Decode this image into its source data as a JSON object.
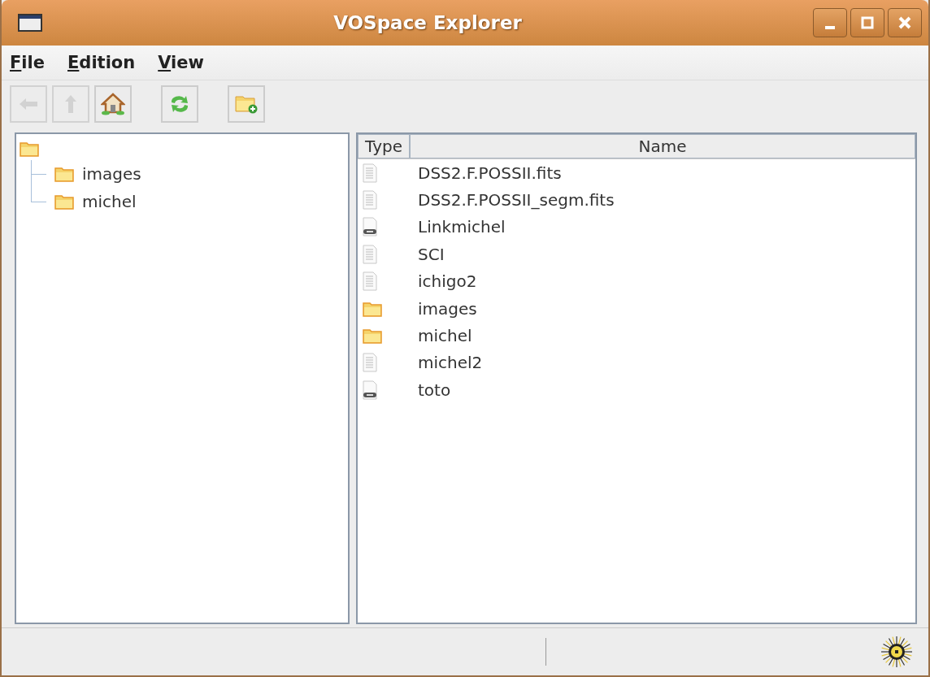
{
  "window": {
    "title": "VOSpace Explorer"
  },
  "menu": [
    "File",
    "Edition",
    "View"
  ],
  "toolbar": [
    {
      "kind": "back",
      "disabled": true
    },
    {
      "kind": "up",
      "disabled": true
    },
    {
      "kind": "home",
      "disabled": false
    },
    {
      "kind": "refresh",
      "disabled": false
    },
    {
      "kind": "new-folder",
      "disabled": false
    }
  ],
  "tree": {
    "children": [
      {
        "label": "images"
      },
      {
        "label": "michel"
      }
    ]
  },
  "table": {
    "columns": [
      "Type",
      "Name"
    ],
    "rows": [
      {
        "kind": "file",
        "name": "DSS2.F.POSSII.fits"
      },
      {
        "kind": "file",
        "name": "DSS2.F.POSSII_segm.fits"
      },
      {
        "kind": "link",
        "name": "Linkmichel"
      },
      {
        "kind": "file",
        "name": "SCI"
      },
      {
        "kind": "file",
        "name": "ichigo2"
      },
      {
        "kind": "folder",
        "name": "images"
      },
      {
        "kind": "folder",
        "name": "michel"
      },
      {
        "kind": "file",
        "name": "michel2"
      },
      {
        "kind": "link",
        "name": "toto"
      }
    ]
  }
}
